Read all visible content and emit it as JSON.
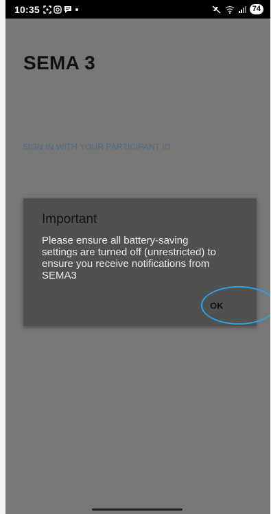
{
  "status_bar": {
    "time": "10:35",
    "battery_level": "74",
    "icons": [
      "screenshot-icon",
      "instagram-icon",
      "messaging-icon",
      "dot-icon",
      "mute-icon",
      "wifi-icon",
      "signal-icon"
    ]
  },
  "app": {
    "title": "SEMA 3",
    "sign_in_label": "SIGN IN WITH YOUR PARTICIPANT ID"
  },
  "dialog": {
    "title": "Important",
    "message": "Please ensure all battery-saving settings are turned off (unrestricted) to ensure you receive notifications from SEMA3",
    "ok_label": "OK"
  },
  "colors": {
    "overlay": "#777777",
    "dialog_bg": "#505050",
    "highlight": "#22a6e6"
  }
}
